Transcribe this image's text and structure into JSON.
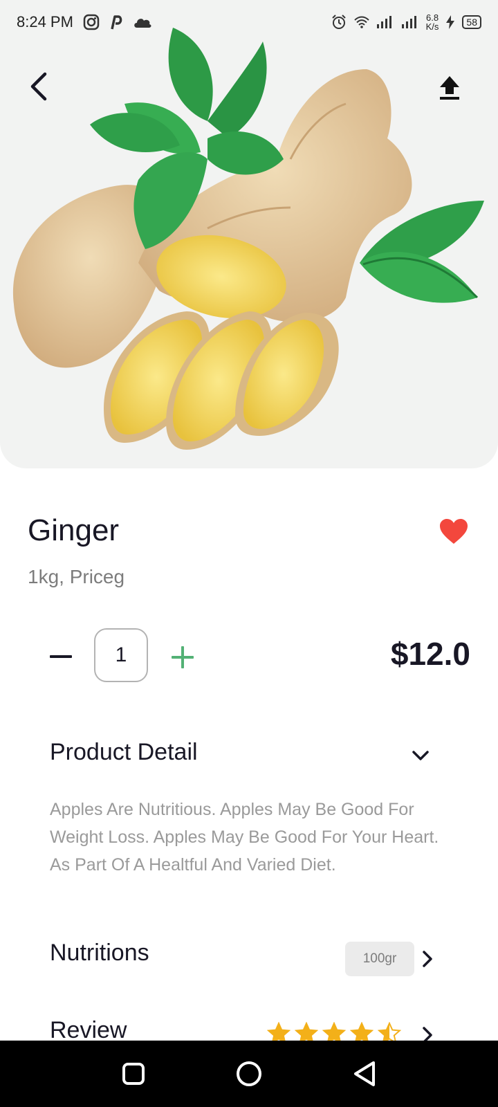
{
  "status_bar": {
    "time": "8:24 PM",
    "net_speed_value": "6.8",
    "net_speed_unit": "K/s",
    "battery": "58"
  },
  "product": {
    "name": "Ginger",
    "subtitle": "1kg, Priceg",
    "quantity": "1",
    "price": "$12.0",
    "favorite": true,
    "favorite_color": "#f3473d",
    "accent_color": "#53b175"
  },
  "sections": {
    "detail_title": "Product Detail",
    "detail_text": "Apples Are Nutritious. Apples May Be Good For Weight Loss. Apples May Be Good For Your Heart. As Part Of A Healtful And Varied Diet.",
    "nutritions_title": "Nutritions",
    "nutritions_badge": "100gr",
    "review_title": "Review",
    "review_rating": 4.5,
    "star_color": "#f3b019"
  },
  "icons": {
    "back": "chevron-left-icon",
    "share": "upload-icon",
    "favorite": "heart-icon",
    "minus": "minus-icon",
    "plus": "plus-icon",
    "expand": "chevron-down-icon",
    "more": "chevron-right-icon"
  }
}
